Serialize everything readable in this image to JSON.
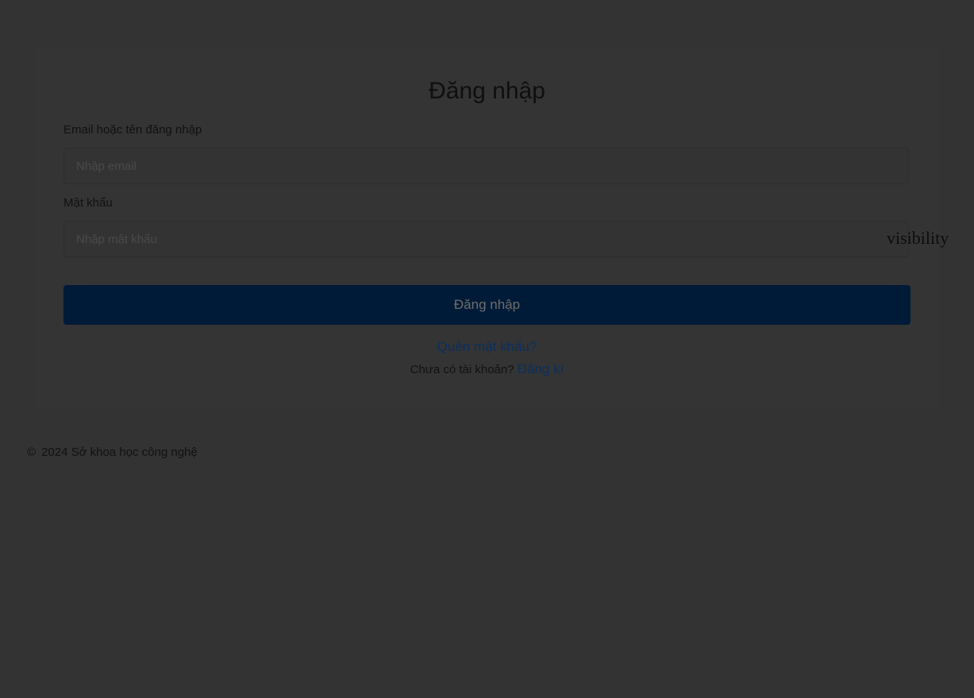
{
  "login": {
    "title": "Đăng nhập",
    "email_label": "Email hoặc tên đăng nhập",
    "email_placeholder": "Nhập email",
    "email_value": "",
    "password_label": "Mật khẩu",
    "password_placeholder": "Nhập mật khẩu",
    "password_value": "",
    "visibility_toggle": "visibility",
    "submit_label": "Đăng nhập",
    "forgot_label": "Quên mật khẩu?",
    "no_account_text": "Chưa có tài khoản?",
    "register_label": "Đăng kí"
  },
  "footer": {
    "copyright_symbol": "©",
    "text": "2024 Sở khoa học công nghệ"
  },
  "colors": {
    "background": "#333333",
    "button_bg": "#001b37",
    "link": "#0a2f5e"
  }
}
